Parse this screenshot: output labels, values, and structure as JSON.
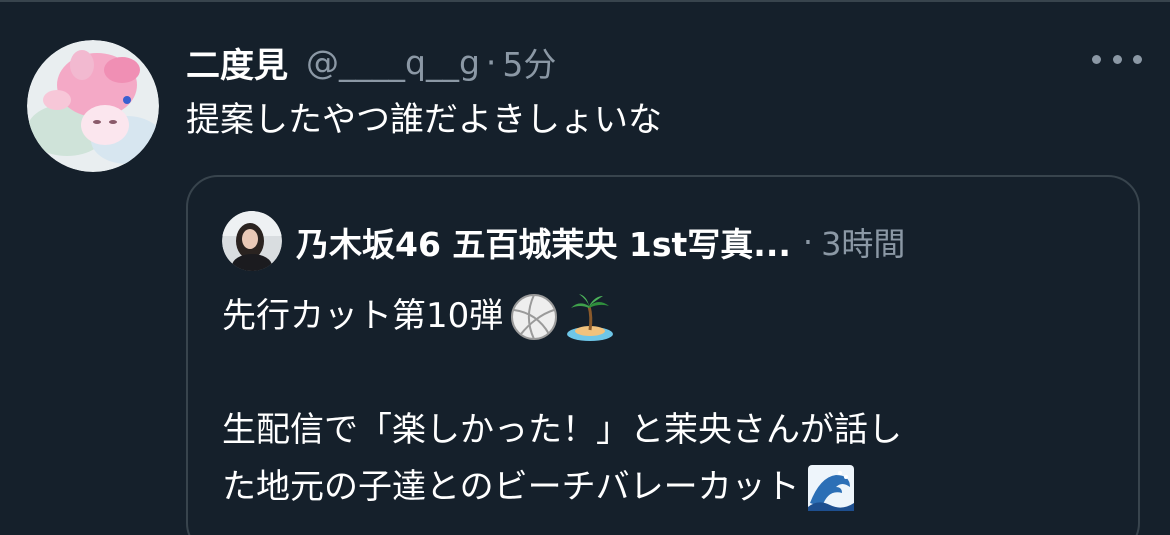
{
  "tweet": {
    "display_name": "二度見",
    "handle": "@____q__g",
    "separator": "·",
    "time": "5分",
    "text": "提案したやつ誰だよきしょいな",
    "more_icon": "more-horizontal-icon"
  },
  "quote": {
    "display_name": "乃木坂46 五百城茉央 1st写真...",
    "separator": "·",
    "time": "3時間",
    "line1": "先行カット第10弾",
    "line2": "生配信で「楽しかった！」と茉央さんが話し",
    "line3": "た地元の子達とのビーチバレーカット",
    "emoji1": "volleyball-emoji",
    "emoji2": "desert-island-emoji",
    "emoji3": "water-wave-emoji"
  },
  "colors": {
    "background": "#15202b",
    "secondary_text": "#8b98a5",
    "border": "#38444d",
    "primary_text": "#ffffff"
  }
}
